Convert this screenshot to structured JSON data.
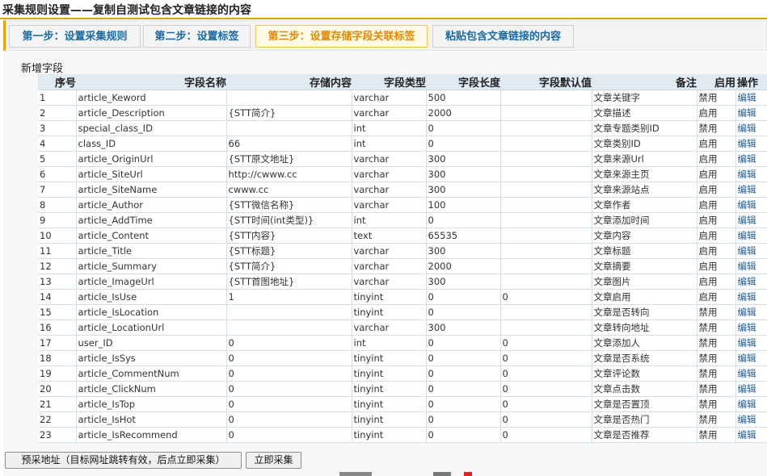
{
  "page_title": "采集规则设置——复制自测试包含文章链接的内容",
  "tabs": [
    {
      "label": "第一步：设置采集规则"
    },
    {
      "label": "第二步：设置标签"
    },
    {
      "label": "第三步：设置存储字段关联标签",
      "active": true
    },
    {
      "label": "粘贴包含文章链接的内容"
    }
  ],
  "new_field_label": "新增字段",
  "columns": [
    "序号",
    "字段名称",
    "存储内容",
    "字段类型",
    "字段长度",
    "字段默认值",
    "备注",
    "启用",
    "操作"
  ],
  "rows": [
    {
      "no": "1",
      "name": "article_Keword",
      "content": "",
      "type": "varchar",
      "length": "500",
      "default": "",
      "remark": "文章关键字",
      "status": "禁用",
      "op": "编辑"
    },
    {
      "no": "2",
      "name": "article_Description",
      "content": "{STT简介}",
      "type": "varchar",
      "length": "2000",
      "default": "",
      "remark": "文章描述",
      "status": "启用",
      "op": "编辑"
    },
    {
      "no": "3",
      "name": "special_class_ID",
      "content": "",
      "type": "int",
      "length": "0",
      "default": "",
      "remark": "文章专题类别ID",
      "status": "禁用",
      "op": "编辑"
    },
    {
      "no": "4",
      "name": "class_ID",
      "content": "66",
      "type": "int",
      "length": "0",
      "default": "",
      "remark": "文章类别ID",
      "status": "启用",
      "op": "编辑"
    },
    {
      "no": "5",
      "name": "article_OriginUrl",
      "content": "{STT原文地址}",
      "type": "varchar",
      "length": "300",
      "default": "",
      "remark": "文章来源Url",
      "status": "启用",
      "op": "编辑"
    },
    {
      "no": "6",
      "name": "article_SiteUrl",
      "content": "http://cwww.cc",
      "type": "varchar",
      "length": "300",
      "default": "",
      "remark": "文章来源主页",
      "status": "启用",
      "op": "编辑"
    },
    {
      "no": "7",
      "name": "article_SiteName",
      "content": "cwww.cc",
      "type": "varchar",
      "length": "300",
      "default": "",
      "remark": "文章来源站点",
      "status": "启用",
      "op": "编辑"
    },
    {
      "no": "8",
      "name": "article_Author",
      "content": "{STT微信名称}",
      "type": "varchar",
      "length": "100",
      "default": "",
      "remark": "文章作者",
      "status": "启用",
      "op": "编辑"
    },
    {
      "no": "9",
      "name": "article_AddTime",
      "content": "{STT时间(int类型)}",
      "type": "int",
      "length": "0",
      "default": "",
      "remark": "文章添加时间",
      "status": "启用",
      "op": "编辑"
    },
    {
      "no": "10",
      "name": "article_Content",
      "content": "{STT内容}",
      "type": "text",
      "length": "65535",
      "default": "",
      "remark": "文章内容",
      "status": "启用",
      "op": "编辑"
    },
    {
      "no": "11",
      "name": "article_Title",
      "content": "{STT标题}",
      "type": "varchar",
      "length": "300",
      "default": "",
      "remark": "文章标题",
      "status": "启用",
      "op": "编辑"
    },
    {
      "no": "12",
      "name": "article_Summary",
      "content": "{STT简介}",
      "type": "varchar",
      "length": "2000",
      "default": "",
      "remark": "文章摘要",
      "status": "启用",
      "op": "编辑"
    },
    {
      "no": "13",
      "name": "article_ImageUrl",
      "content": "{STT首图地址}",
      "type": "varchar",
      "length": "300",
      "default": "",
      "remark": "文章图片",
      "status": "启用",
      "op": "编辑"
    },
    {
      "no": "14",
      "name": "article_IsUse",
      "content": "1",
      "type": "tinyint",
      "length": "0",
      "default": "0",
      "remark": "文章启用",
      "status": "启用",
      "op": "编辑"
    },
    {
      "no": "15",
      "name": "article_IsLocation",
      "content": "",
      "type": "tinyint",
      "length": "0",
      "default": "",
      "remark": "文章是否转向",
      "status": "禁用",
      "op": "编辑"
    },
    {
      "no": "16",
      "name": "article_LocationUrl",
      "content": "",
      "type": "varchar",
      "length": "300",
      "default": "",
      "remark": "文章转向地址",
      "status": "禁用",
      "op": "编辑"
    },
    {
      "no": "17",
      "name": "user_ID",
      "content": "0",
      "type": "int",
      "length": "0",
      "default": "0",
      "remark": "文章添加人",
      "status": "禁用",
      "op": "编辑"
    },
    {
      "no": "18",
      "name": "article_IsSys",
      "content": "0",
      "type": "tinyint",
      "length": "0",
      "default": "0",
      "remark": "文章是否系统",
      "status": "禁用",
      "op": "编辑"
    },
    {
      "no": "19",
      "name": "article_CommentNum",
      "content": "0",
      "type": "tinyint",
      "length": "0",
      "default": "0",
      "remark": "文章评论数",
      "status": "禁用",
      "op": "编辑"
    },
    {
      "no": "20",
      "name": "article_ClickNum",
      "content": "0",
      "type": "tinyint",
      "length": "0",
      "default": "0",
      "remark": "文章点击数",
      "status": "禁用",
      "op": "编辑"
    },
    {
      "no": "21",
      "name": "article_IsTop",
      "content": "0",
      "type": "tinyint",
      "length": "0",
      "default": "0",
      "remark": "文章是否置顶",
      "status": "禁用",
      "op": "编辑"
    },
    {
      "no": "22",
      "name": "article_IsHot",
      "content": "0",
      "type": "tinyint",
      "length": "0",
      "default": "0",
      "remark": "文章是否热门",
      "status": "禁用",
      "op": "编辑"
    },
    {
      "no": "23",
      "name": "article_IsRecommend",
      "content": "0",
      "type": "tinyint",
      "length": "0",
      "default": "0",
      "remark": "文章是否推荐",
      "status": "禁用",
      "op": "编辑"
    }
  ],
  "buttons": {
    "preview": "预采地址（目标网址跳转有效，后点立即采集）",
    "collect": "立即采集"
  },
  "colors": {
    "accent": "#e8a000",
    "header_bg": "#dfeaf2",
    "link": "#1a6aa3"
  }
}
